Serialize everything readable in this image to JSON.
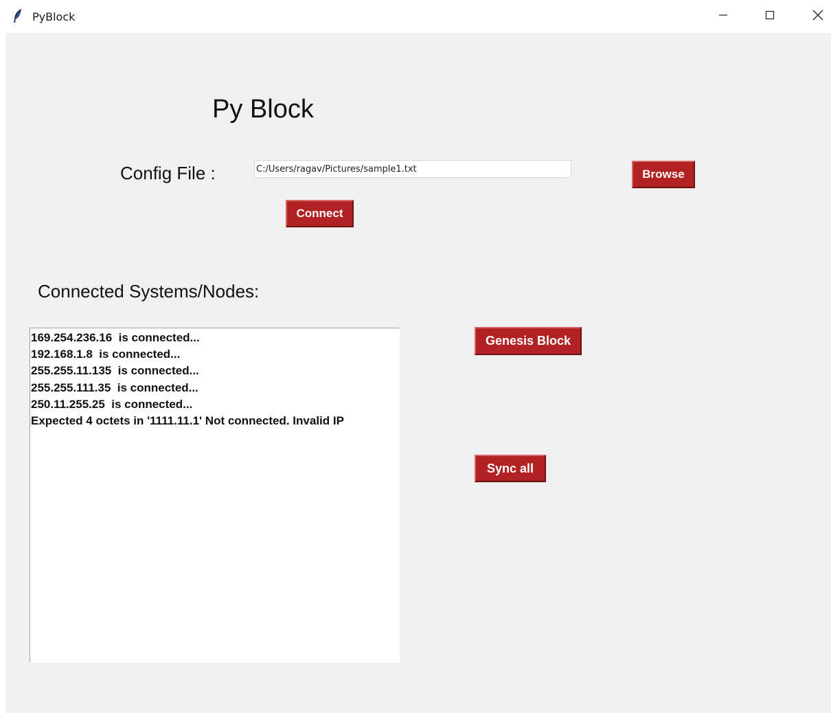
{
  "window": {
    "title": "PyBlock",
    "icon": "feather-icon",
    "controls": [
      "minimize-icon",
      "maximize-icon",
      "close-icon"
    ]
  },
  "header": {
    "title": "Py Block"
  },
  "config": {
    "label": "Config File :",
    "path_value": "C:/Users/ragav/Pictures/sample1.txt",
    "browse_label": "Browse",
    "connect_label": "Connect"
  },
  "nodes": {
    "label": "Connected Systems/Nodes:",
    "lines": [
      "169.254.236.16  is connected...",
      "192.168.1.8  is connected...",
      "255.255.11.135  is connected...",
      "255.255.111.35  is connected...",
      "250.11.255.25  is connected...",
      "Expected 4 octets in '1111.11.1' Not connected. Invalid IP"
    ]
  },
  "actions": {
    "genesis_label": "Genesis Block",
    "sync_label": "Sync all"
  },
  "colors": {
    "button_bg": "#b22222",
    "button_text": "#ffffff",
    "client_bg": "#f0f0f0"
  }
}
